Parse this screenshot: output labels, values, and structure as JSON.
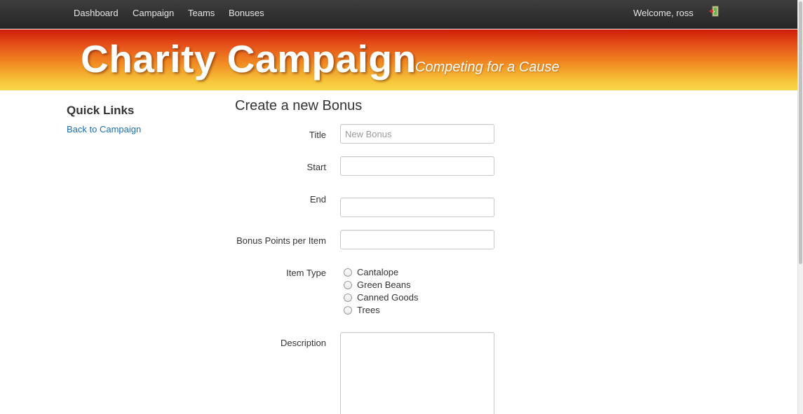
{
  "nav": {
    "items": [
      "Dashboard",
      "Campaign",
      "Teams",
      "Bonuses"
    ],
    "welcome": "Welcome, ross",
    "logout_icon": "exit-door-icon"
  },
  "banner": {
    "title": "Charity Campaign",
    "tagline": "Competing for a Cause"
  },
  "sidebar": {
    "title": "Quick Links",
    "links": [
      "Back to Campaign"
    ]
  },
  "form": {
    "heading": "Create a new Bonus",
    "title_label": "Title",
    "title_placeholder": "New Bonus",
    "title_value": "",
    "start_label": "Start",
    "start_value": "",
    "end_label": "End",
    "end_value": "",
    "points_label": "Bonus Points per Item",
    "points_value": "",
    "item_type_label": "Item Type",
    "item_types": [
      "Cantalope",
      "Green Beans",
      "Canned Goods",
      "Trees"
    ],
    "description_label": "Description",
    "description_value": ""
  },
  "colors": {
    "navbar": "#2f2f2f",
    "link": "#1a6db3",
    "banner_top": "#cf1c06",
    "banner_bottom": "#f9d84a"
  }
}
